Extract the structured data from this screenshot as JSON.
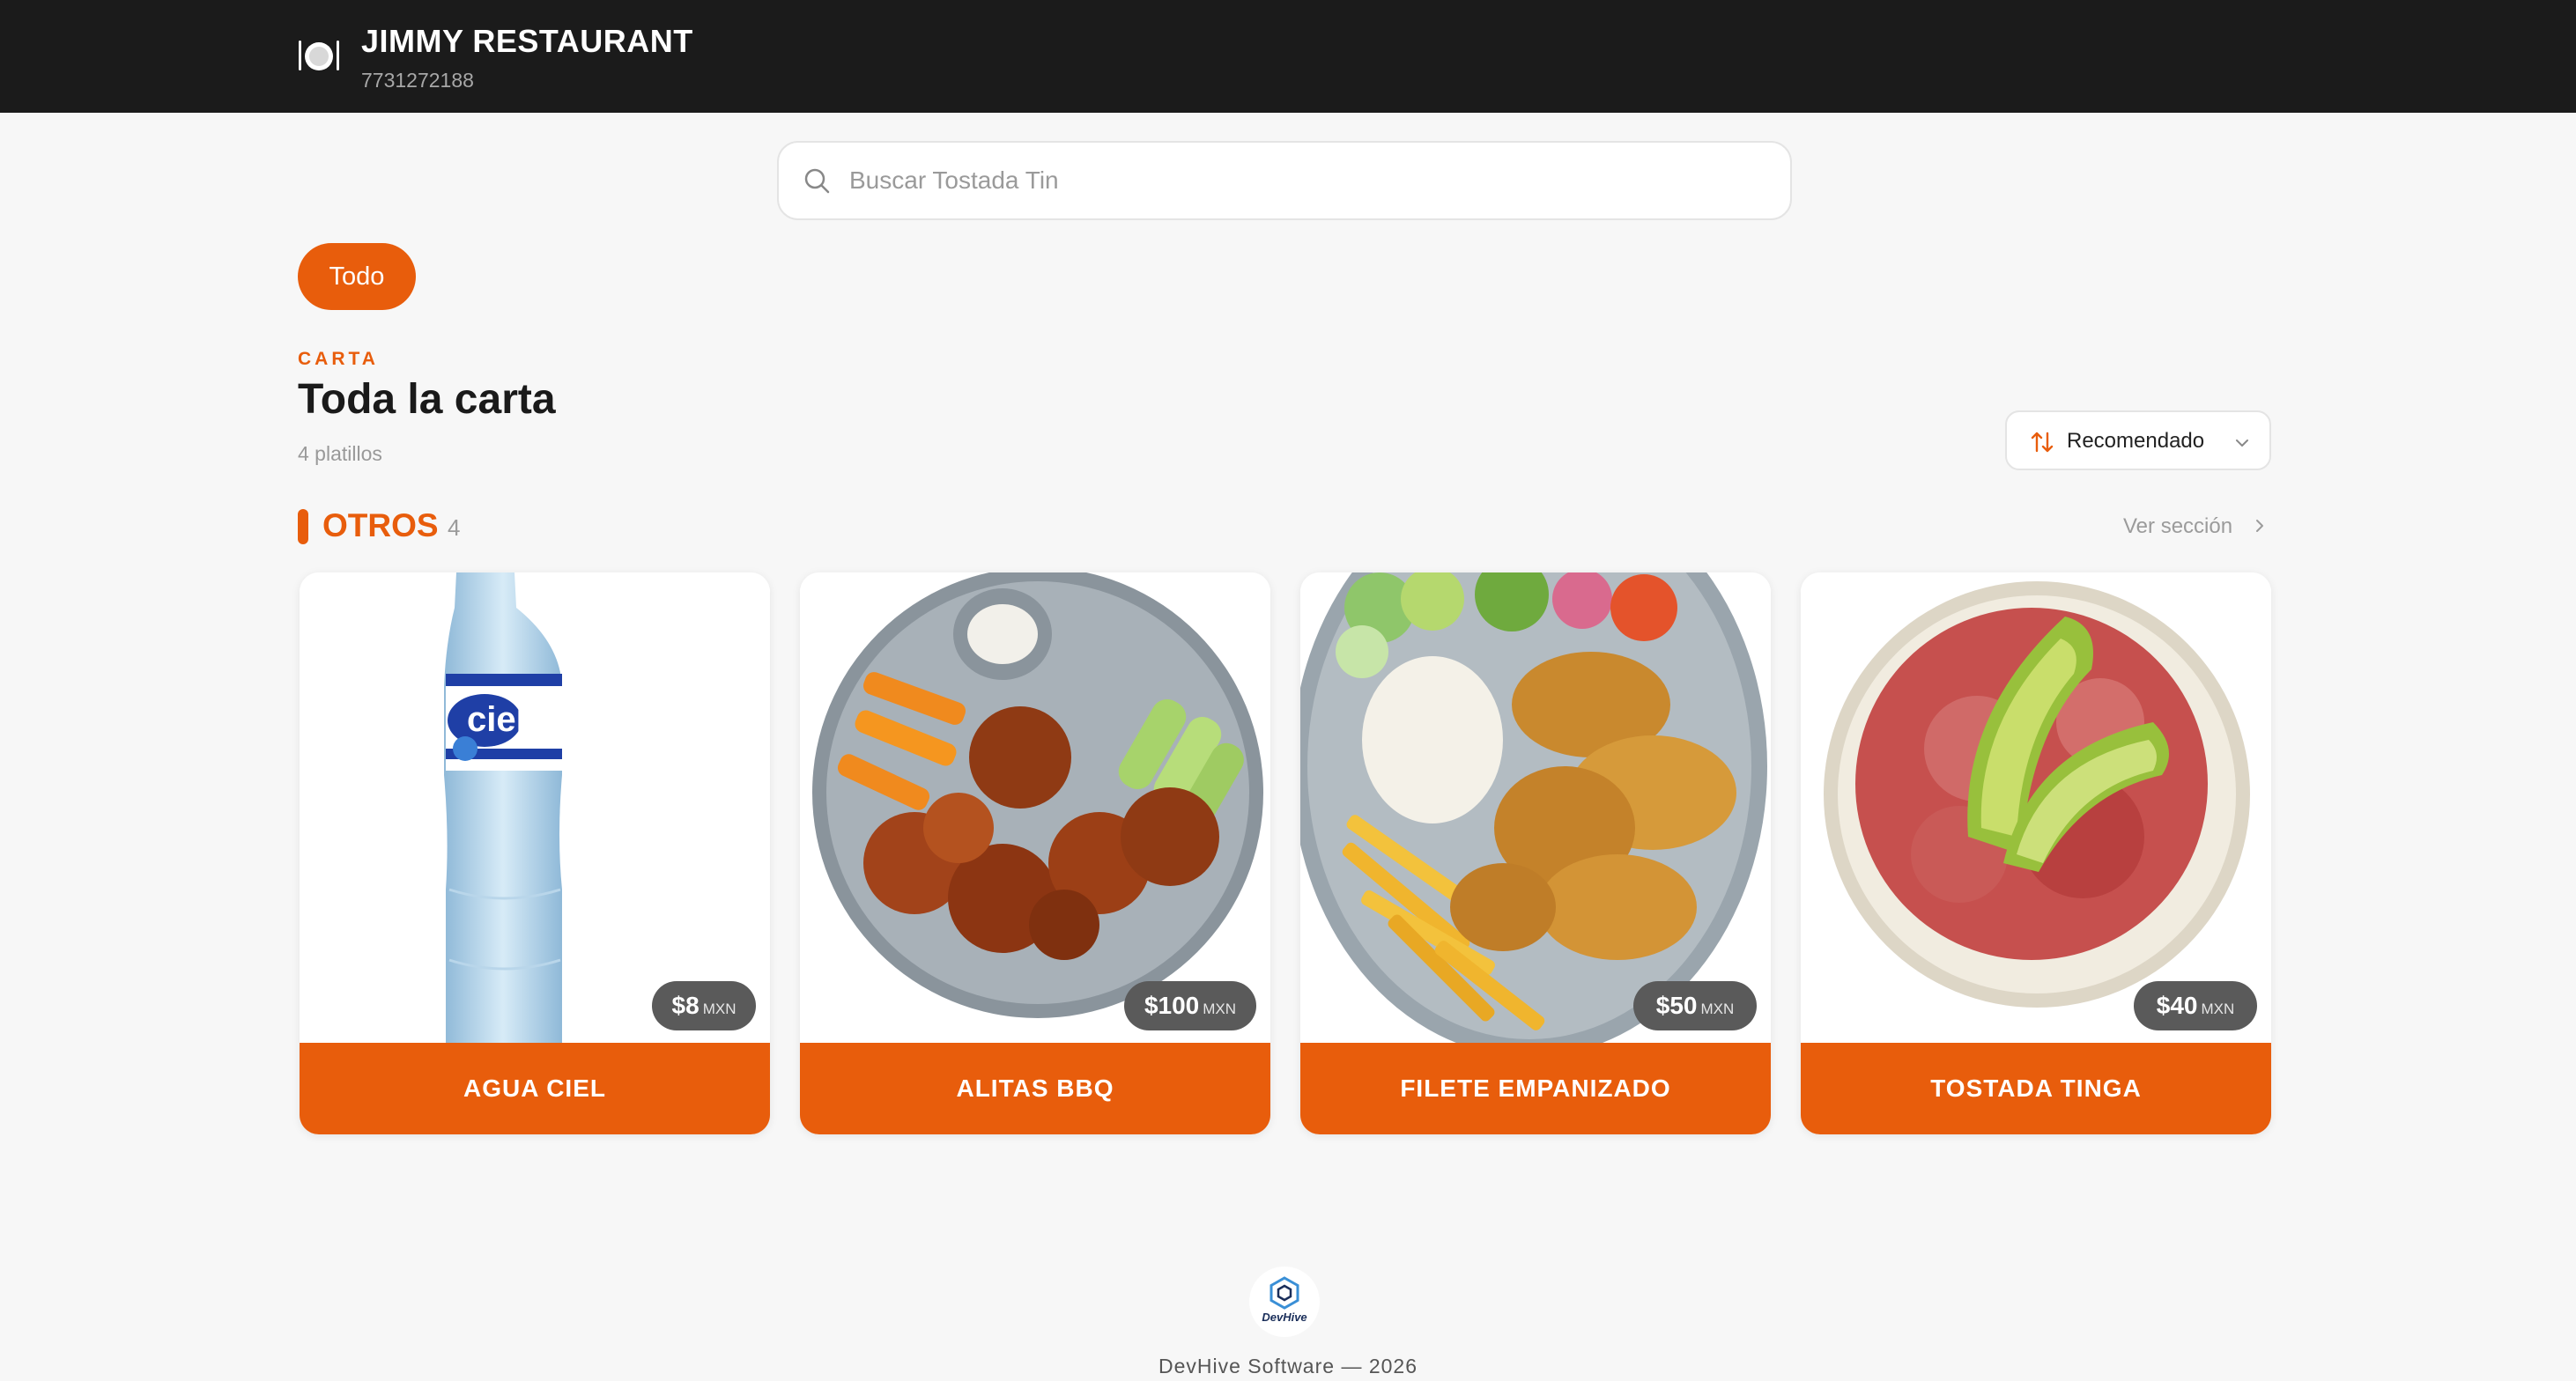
{
  "header": {
    "restaurant_name": "JIMMY RESTAURANT",
    "phone": "7731272188",
    "icon": "plate-utensils-icon"
  },
  "search": {
    "placeholder": "Buscar Tostada Tin",
    "value": "",
    "icon": "search-icon"
  },
  "filters": [
    {
      "label": "Todo",
      "active": true
    }
  ],
  "heading": {
    "eyebrow": "CARTA",
    "title": "Toda la carta",
    "count": "4 platillos"
  },
  "sort": {
    "label": "Recomendado",
    "icon": "sort-arrows-icon"
  },
  "section": {
    "title": "OTROS",
    "count": "4",
    "see_all": "Ver sección"
  },
  "products": [
    {
      "name": "AGUA CIEL",
      "price": "$8",
      "currency": "MXN",
      "image": "water-bottle"
    },
    {
      "name": "ALITAS BBQ",
      "price": "$100",
      "currency": "MXN",
      "image": "bbq-wings"
    },
    {
      "name": "FILETE EMPANIZADO",
      "price": "$50",
      "currency": "MXN",
      "image": "breaded-fillet"
    },
    {
      "name": "TOSTADA TINGA",
      "price": "$40",
      "currency": "MXN",
      "image": "tostada-tinga"
    }
  ],
  "footer": {
    "logo_text": "DevHive",
    "text": "DevHive Software — 2026"
  },
  "colors": {
    "accent": "#e85d0c",
    "header_bg": "#1b1b1b",
    "page_bg": "#f7f7f7",
    "price_badge": "#5a5a5a"
  }
}
